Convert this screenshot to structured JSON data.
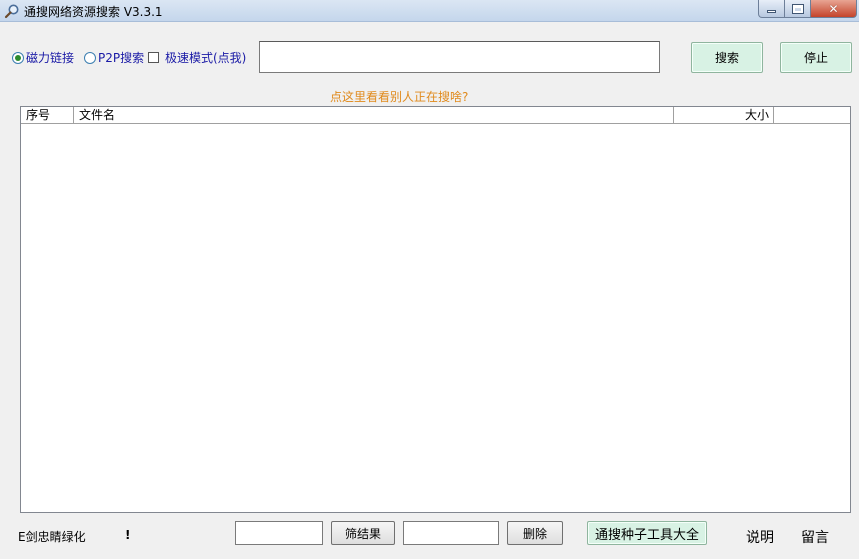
{
  "window": {
    "title": "通搜网络资源搜索 V3.3.1",
    "icon": "magnifier-icon"
  },
  "options": {
    "magnet_label": "磁力链接",
    "magnet_selected": true,
    "p2p_label": "P2P搜索",
    "p2p_selected": false,
    "fast_mode_label": "极速模式(点我)",
    "fast_mode_checked": false
  },
  "search": {
    "query": "",
    "search_button": "搜索",
    "stop_button": "停止"
  },
  "hint": {
    "text": "点这里看看别人正在搜啥?",
    "color": "#e08a1c"
  },
  "results_table": {
    "columns": [
      "序号",
      "文件名",
      "大小",
      ""
    ],
    "rows": []
  },
  "bottom": {
    "status_left": "E剑忠睛绿化",
    "status_mark": "!",
    "filter_input": "",
    "filter_button": "筛结果",
    "delete_input": "",
    "delete_button": "删除",
    "tools_button": "通搜种子工具大全",
    "help_link": "说明",
    "message_link": "留言"
  },
  "colors": {
    "accent_button": "#d8f2e4",
    "option_text": "#1a1aa6"
  }
}
